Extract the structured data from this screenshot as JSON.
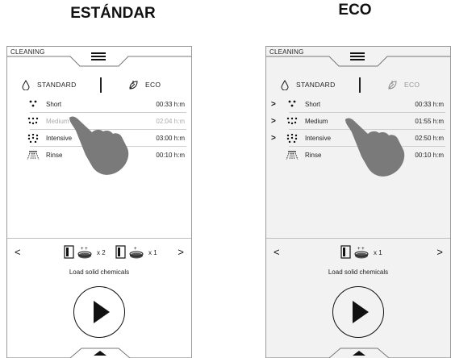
{
  "headings": {
    "left": "ESTÁNDAR",
    "right": "ECO"
  },
  "panels": [
    {
      "app_label": "CLEANING",
      "modes": {
        "standard": "STANDARD",
        "eco": "ECO",
        "selected": "standard"
      },
      "programs": [
        {
          "name": "Short",
          "time": "00:33 h:m",
          "icon": "spray-3-icon",
          "dimmed": false,
          "chevron": false
        },
        {
          "name": "Medium",
          "time": "02:04 h:m",
          "icon": "spray-6-icon",
          "dimmed": true,
          "chevron": false
        },
        {
          "name": "Intensive",
          "time": "03:00 h:m",
          "icon": "spray-9-icon",
          "dimmed": false,
          "chevron": false
        },
        {
          "name": "Rinse",
          "time": "00:10 h:m",
          "icon": "rinse-shower-icon",
          "dimmed": false,
          "chevron": false
        }
      ],
      "chemicals": [
        {
          "multiplier": "x 2"
        },
        {
          "multiplier": "x 1"
        }
      ],
      "load_text": "Load solid chemicals"
    },
    {
      "app_label": "CLEANING",
      "modes": {
        "standard": "STANDARD",
        "eco": "ECO",
        "selected": "standard"
      },
      "programs": [
        {
          "name": "Short",
          "time": "00:33 h:m",
          "icon": "spray-3-icon",
          "dimmed": false,
          "chevron": true
        },
        {
          "name": "Medium",
          "time": "01:55 h:m",
          "icon": "spray-6-icon",
          "dimmed": false,
          "chevron": true
        },
        {
          "name": "Intensive",
          "time": "02:50 h:m",
          "icon": "spray-9-icon",
          "dimmed": false,
          "chevron": true
        },
        {
          "name": "Rinse",
          "time": "00:10 h:m",
          "icon": "rinse-shower-icon",
          "dimmed": false,
          "chevron": false
        }
      ],
      "chemicals": [
        {
          "multiplier": "x 1"
        }
      ],
      "load_text": "Load solid chemicals"
    }
  ],
  "nav": {
    "prev_glyph": "<",
    "next_glyph": ">",
    "chevron_glyph": ">"
  }
}
